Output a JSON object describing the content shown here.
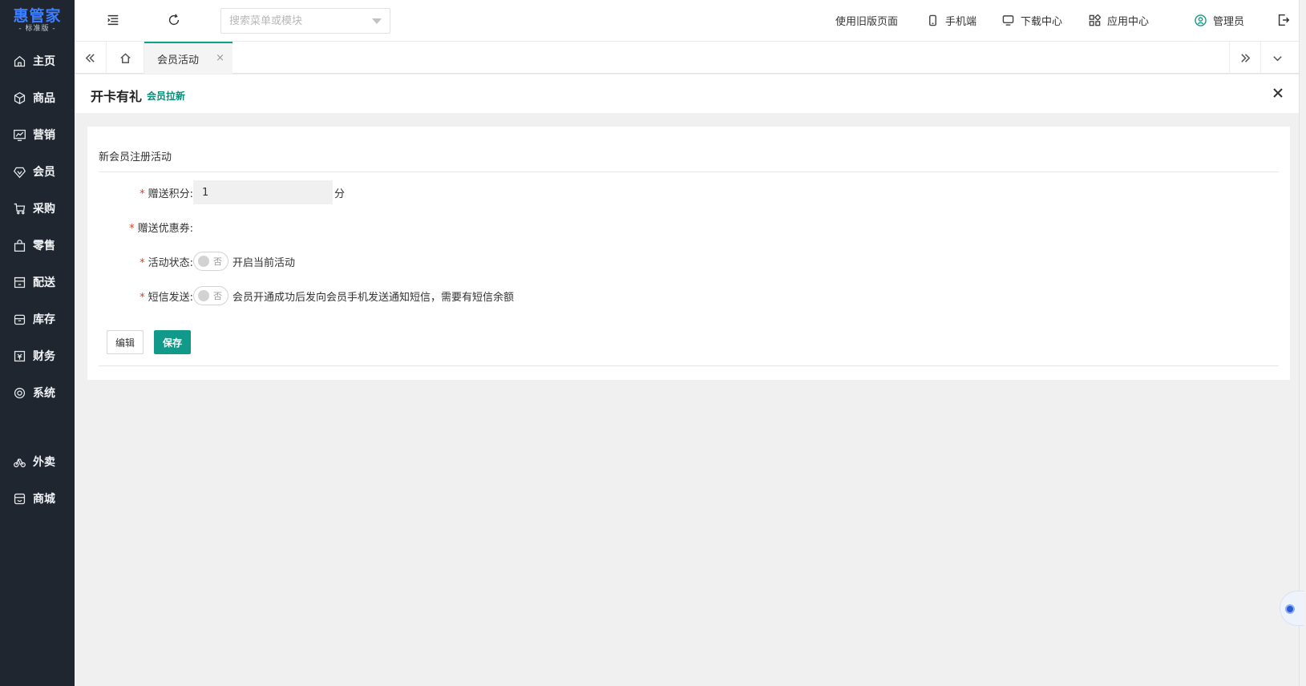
{
  "sidebar": {
    "logo": {
      "main": "惠管家",
      "sub": "- 标准版 -"
    },
    "items": [
      {
        "label": "主页",
        "icon": "home-icon"
      },
      {
        "label": "商品",
        "icon": "box-icon"
      },
      {
        "label": "营销",
        "icon": "chart-icon"
      },
      {
        "label": "会员",
        "icon": "diamond-icon"
      },
      {
        "label": "采购",
        "icon": "cart-icon"
      },
      {
        "label": "零售",
        "icon": "bag-icon"
      },
      {
        "label": "配送",
        "icon": "store-icon"
      },
      {
        "label": "库存",
        "icon": "inventory-icon"
      },
      {
        "label": "财务",
        "icon": "finance-icon"
      },
      {
        "label": "系统",
        "icon": "settings-icon"
      },
      {
        "label": "外卖",
        "icon": "bike-icon"
      },
      {
        "label": "商城",
        "icon": "shop-icon"
      }
    ]
  },
  "header": {
    "search_placeholder": "搜索菜单或模块",
    "links": {
      "old_version": "使用旧版页面",
      "mobile": "手机端",
      "download": "下载中心",
      "apps": "应用中心",
      "user": "管理员"
    }
  },
  "tabs": {
    "active": {
      "label": "会员活动",
      "close": "×"
    }
  },
  "page": {
    "title": "开卡有礼",
    "subtitle": "会员拉新"
  },
  "form": {
    "section_title": "新会员注册活动",
    "required_mark": "*",
    "points": {
      "label": "赠送积分:",
      "value": "1",
      "unit": "分"
    },
    "coupon": {
      "label": "赠送优惠券:"
    },
    "status": {
      "label": "活动状态:",
      "switch_text": "否",
      "description": "开启当前活动"
    },
    "sms": {
      "label": "短信发送:",
      "switch_text": "否",
      "description": "会员开通成功后发向会员手机发送通知短信，需要有短信余额"
    },
    "buttons": {
      "edit": "编辑",
      "save": "保存"
    }
  },
  "colors": {
    "sidebar_bg": "#1f2630",
    "logo_blue": "#3d7fff",
    "accent_green": "#11998a",
    "required_red": "#e63b1e"
  }
}
